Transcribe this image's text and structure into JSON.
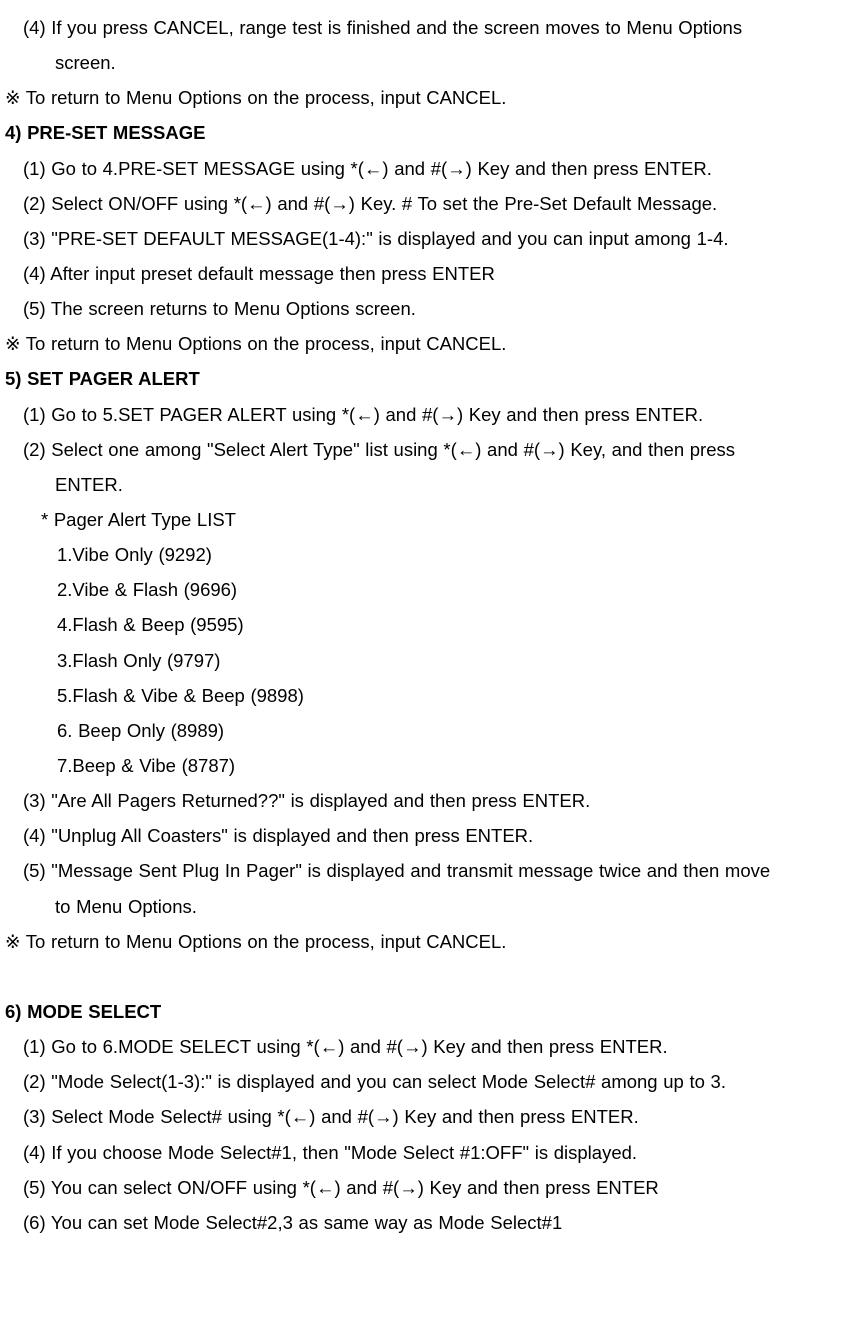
{
  "lines": [
    {
      "text": "(4) If you press CANCEL, range test is finished and the screen moves to Menu Options",
      "cls": "indent1"
    },
    {
      "text": "screen.",
      "cls": "hang1"
    },
    {
      "text": "※ To return to Menu Options on the process, input CANCEL.",
      "cls": ""
    },
    {
      "text": "4) PRE-SET MESSAGE",
      "cls": "bold"
    },
    {
      "text": "(1) Go to 4.PRE-SET MESSAGE using *(←) and #(→) Key and then press ENTER.",
      "cls": "indent1"
    },
    {
      "text": "(2) Select ON/OFF using *(←) and #(→) Key. # To set the Pre-Set Default Message.",
      "cls": "indent1"
    },
    {
      "text": "(3) \"PRE-SET DEFAULT MESSAGE(1-4):\" is displayed and you can input among 1-4.",
      "cls": "indent1"
    },
    {
      "text": "(4) After input preset default message then press ENTER",
      "cls": "indent1"
    },
    {
      "text": "(5) The screen returns to Menu Options screen.",
      "cls": "indent1"
    },
    {
      "text": "※ To return to Menu Options on the process, input CANCEL.",
      "cls": ""
    },
    {
      "text": "5) SET PAGER ALERT",
      "cls": "bold"
    },
    {
      "text": "(1) Go to 5.SET PAGER ALERT using *(←) and #(→) Key and then press ENTER.",
      "cls": "indent1"
    },
    {
      "text": "(2) Select one among \"Select Alert Type\" list using *(←) and #(→) Key, and then press",
      "cls": "indent1"
    },
    {
      "text": "ENTER.",
      "cls": "hang1"
    },
    {
      "text": "* Pager Alert Type LIST",
      "cls": "indent2"
    },
    {
      "text": "1.Vibe Only (9292)",
      "cls": "indent3"
    },
    {
      "text": "2.Vibe & Flash (9696)",
      "cls": "indent3"
    },
    {
      "text": "4.Flash & Beep (9595)",
      "cls": "indent3"
    },
    {
      "text": "3.Flash Only (9797)",
      "cls": "indent3"
    },
    {
      "text": "5.Flash & Vibe & Beep (9898)",
      "cls": "indent3"
    },
    {
      "text": "6. Beep Only (8989)",
      "cls": "indent3"
    },
    {
      "text": "7.Beep & Vibe (8787)",
      "cls": "indent3"
    },
    {
      "text": "(3) \"Are All Pagers Returned??\" is displayed and then press ENTER.",
      "cls": "indent1"
    },
    {
      "text": "(4) \"Unplug All Coasters\" is displayed and then press ENTER.",
      "cls": "indent1"
    },
    {
      "text": "(5) \"Message Sent Plug In Pager\" is displayed and transmit message twice and then move",
      "cls": "indent1"
    },
    {
      "text": "to Menu Options.",
      "cls": "hang1"
    },
    {
      "text": "※ To return to Menu Options on the process, input CANCEL.",
      "cls": ""
    },
    {
      "text": " ",
      "cls": ""
    },
    {
      "text": "6) MODE SELECT",
      "cls": "bold"
    },
    {
      "text": "(1) Go to 6.MODE SELECT using *(←) and #(→) Key and then press ENTER.",
      "cls": "indent1"
    },
    {
      "text": "(2) \"Mode Select(1-3):\" is displayed and you can select Mode Select# among up to 3.",
      "cls": "indent1"
    },
    {
      "text": "(3) Select Mode Select# using *(←) and #(→) Key and then press ENTER.",
      "cls": "indent1"
    },
    {
      "text": "(4) If you choose Mode Select#1, then \"Mode Select #1:OFF\" is displayed.",
      "cls": "indent1"
    },
    {
      "text": "(5) You can select ON/OFF using *(←) and #(→) Key and then press ENTER",
      "cls": "indent1"
    },
    {
      "text": "(6) You can set Mode Select#2,3 as same way as Mode Select#1",
      "cls": "indent1"
    }
  ]
}
